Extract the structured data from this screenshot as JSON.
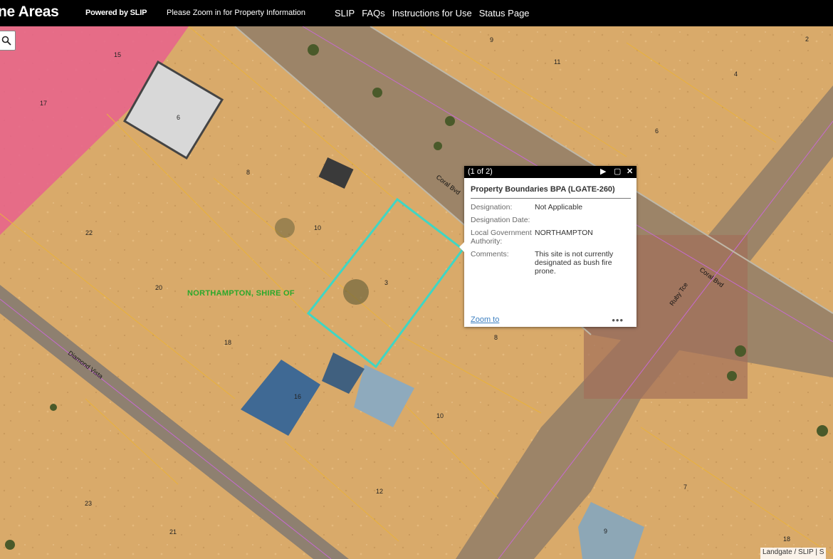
{
  "header": {
    "app_title": "ne Areas",
    "powered_by": "Powered by SLIP",
    "zoom_message": "Please Zoom in for Property Information",
    "nav": [
      "SLIP",
      "FAQs",
      "Instructions for Use",
      "Status Page"
    ]
  },
  "map": {
    "lot_numbers": [
      "15",
      "17",
      "6",
      "8",
      "22",
      "10",
      "3",
      "20",
      "18",
      "16",
      "10",
      "12",
      "23",
      "21",
      "9",
      "11",
      "2",
      "4",
      "6",
      "8",
      "7",
      "9",
      "18"
    ],
    "roads": [
      "Coral Bvd",
      "Coral Bvd",
      "Ruby Tce",
      "Diamond Vista"
    ],
    "shire_label": "NORTHAMPTON, SHIRE OF",
    "colors": {
      "ground": "#d9aa6a",
      "road": "#9c8468",
      "bpa_zone": "#e8628c",
      "selection": "#3fd6c4",
      "boundary": "#e9b23c",
      "cadastre": "#d77ad6"
    }
  },
  "popup": {
    "count": "(1 of 2)",
    "title": "Property Boundaries BPA (LGATE-260)",
    "fields": [
      {
        "label": "Designation:",
        "value": "Not Applicable"
      },
      {
        "label": "Designation Date:",
        "value": ""
      },
      {
        "label": "Local Government Authority:",
        "value": "NORTHAMPTON"
      },
      {
        "label": "Comments:",
        "value": "This site is not currently designated as bush fire prone."
      }
    ],
    "zoom_link": "Zoom to",
    "more": "•••"
  },
  "attribution": "Landgate / SLIP | S"
}
